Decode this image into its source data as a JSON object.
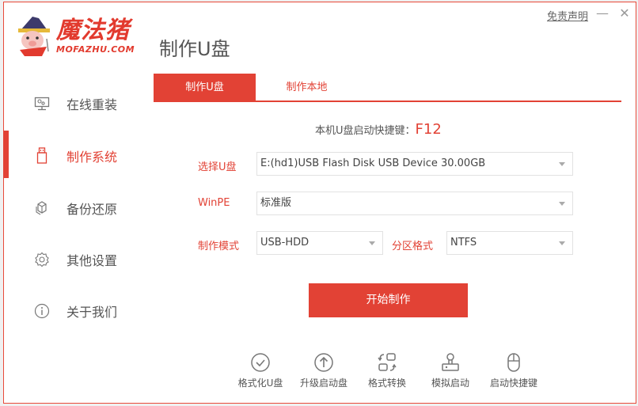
{
  "app": {
    "brand_cn": "魔法猪",
    "brand_en": "MOFAZHU.COM",
    "page_title": "制作U盘",
    "disclaimer": "免责声明",
    "minimize_glyph": "—",
    "close_glyph": "✕"
  },
  "sidebar": {
    "items": [
      {
        "label": "在线重装",
        "icon": "monitor-icon",
        "active": false
      },
      {
        "label": "制作系统",
        "icon": "usb-drive-icon",
        "active": true
      },
      {
        "label": "备份还原",
        "icon": "backup-cube-icon",
        "active": false
      },
      {
        "label": "其他设置",
        "icon": "gear-icon",
        "active": false
      },
      {
        "label": "关于我们",
        "icon": "info-icon",
        "active": false
      }
    ]
  },
  "tabs": [
    {
      "label": "制作U盘",
      "active": true
    },
    {
      "label": "制作本地",
      "active": false
    }
  ],
  "hotkey": {
    "label": "本机U盘启动快捷键：",
    "key": "F12"
  },
  "form": {
    "usb_label": "选择U盘",
    "usb_value": "E:(hd1)USB Flash Disk USB Device 30.00GB",
    "winpe_label": "WinPE",
    "winpe_value": "标准版",
    "mode_label": "制作模式",
    "mode_value": "USB-HDD",
    "partition_label": "分区格式",
    "partition_value": "NTFS"
  },
  "start_button": "开始制作",
  "tools": [
    {
      "label": "格式化U盘",
      "icon": "check-circle-icon"
    },
    {
      "label": "升级启动盘",
      "icon": "arrow-up-circle-icon"
    },
    {
      "label": "格式转换",
      "icon": "convert-icon"
    },
    {
      "label": "模拟启动",
      "icon": "stamp-icon"
    },
    {
      "label": "启动快捷键",
      "icon": "mouse-icon"
    }
  ],
  "colors": {
    "accent": "#e24235",
    "text": "#555555",
    "border": "#e2e2e2"
  }
}
